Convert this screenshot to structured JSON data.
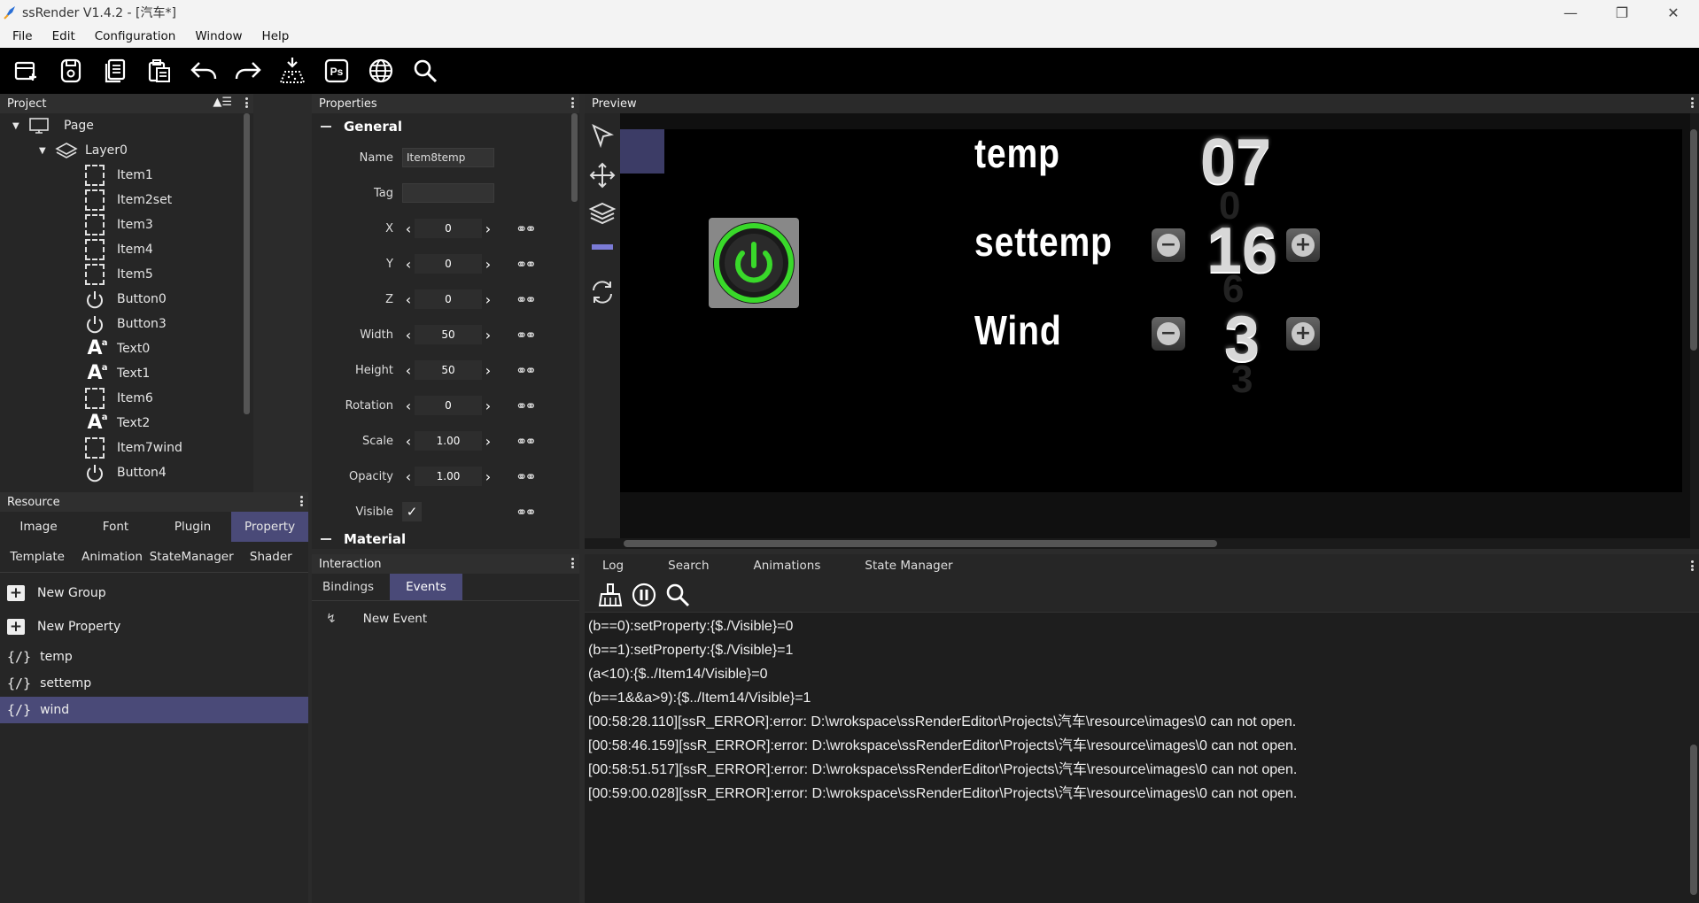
{
  "app": {
    "title": "ssRender V1.4.2 - [汽车*]"
  },
  "menu": [
    "File",
    "Edit",
    "Configuration",
    "Window",
    "Help"
  ],
  "toolbar": {
    "icons": [
      "new-icon",
      "save-icon",
      "copy-icon",
      "paste-icon",
      "undo-icon",
      "redo-icon",
      "export-icon",
      "photoshop-icon",
      "globe-icon",
      "search-icon"
    ],
    "ps_label": "Ps"
  },
  "project": {
    "title": "Project",
    "page": "Page",
    "layer": "Layer0",
    "items": [
      {
        "label": "Item1",
        "kind": "item"
      },
      {
        "label": "Item2set",
        "kind": "item"
      },
      {
        "label": "Item3",
        "kind": "item"
      },
      {
        "label": "Item4",
        "kind": "item"
      },
      {
        "label": "Item5",
        "kind": "item"
      },
      {
        "label": "Button0",
        "kind": "button"
      },
      {
        "label": "Button3",
        "kind": "button"
      },
      {
        "label": "Text0",
        "kind": "text"
      },
      {
        "label": "Text1",
        "kind": "text"
      },
      {
        "label": "Item6",
        "kind": "item"
      },
      {
        "label": "Text2",
        "kind": "text"
      },
      {
        "label": "Item7wind",
        "kind": "item"
      },
      {
        "label": "Button4",
        "kind": "button"
      }
    ]
  },
  "resource": {
    "title": "Resource",
    "tabs_row1": [
      "Image",
      "Font",
      "Plugin",
      "Property"
    ],
    "tabs_row2": [
      "Template",
      "Animation",
      "StateManager",
      "Shader"
    ],
    "active_tab": "Property",
    "actions": [
      "New Group",
      "New Property"
    ],
    "properties": [
      "temp",
      "settemp",
      "wind"
    ],
    "selected": "wind",
    "brace": "{/}"
  },
  "properties": {
    "title": "Properties",
    "section": "General",
    "name_label": "Name",
    "name_value": "Item8temp",
    "tag_label": "Tag",
    "tag_value": "",
    "numeric": [
      {
        "label": "X",
        "value": "0"
      },
      {
        "label": "Y",
        "value": "0"
      },
      {
        "label": "Z",
        "value": "0"
      },
      {
        "label": "Width",
        "value": "50"
      },
      {
        "label": "Height",
        "value": "50"
      },
      {
        "label": "Rotation",
        "value": "0"
      },
      {
        "label": "Scale",
        "value": "1.00"
      },
      {
        "label": "Opacity",
        "value": "1.00"
      }
    ],
    "visible_label": "Visible",
    "visible_checked": true,
    "next_section": "Material"
  },
  "interaction": {
    "title": "Interaction",
    "tabs": [
      "Bindings",
      "Events"
    ],
    "active_tab": "Events",
    "new_event": "New Event"
  },
  "preview": {
    "title": "Preview",
    "rows": [
      {
        "label": "temp",
        "value": "07"
      },
      {
        "label": "settemp",
        "value": "16"
      },
      {
        "label": "Wind",
        "value": "3"
      }
    ],
    "minus": "−",
    "plus": "+"
  },
  "log": {
    "tabs": [
      "Log",
      "Search",
      "Animations",
      "State Manager"
    ],
    "lines": [
      "(b==0):setProperty:{$./Visible}=0",
      "(b==1):setProperty:{$./Visible}=1",
      "(a<10):{$../Item14/Visible}=0",
      "(b==1&&a>9):{$../Item14/Visible}=1",
      "[00:58:28.110][ssR_ERROR]:error: D:\\wrokspace\\ssRenderEditor\\Projects\\汽车\\resource\\images\\0 can not open.",
      "[00:58:46.159][ssR_ERROR]:error: D:\\wrokspace\\ssRenderEditor\\Projects\\汽车\\resource\\images\\0 can not open.",
      "[00:58:51.517][ssR_ERROR]:error: D:\\wrokspace\\ssRenderEditor\\Projects\\汽车\\resource\\images\\0 can not open.",
      "[00:59:00.028][ssR_ERROR]:error: D:\\wrokspace\\ssRenderEditor\\Projects\\汽车\\resource\\images\\0 can not open."
    ]
  },
  "colors": {
    "accent": "#4a4a78",
    "power_green": "#39d92a"
  }
}
